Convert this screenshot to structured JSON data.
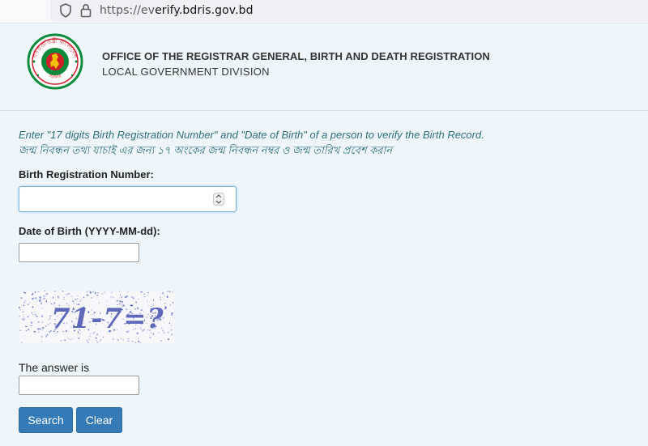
{
  "browser": {
    "url_prefix": "https://ev",
    "url_host": "erify.bdris.gov.bd"
  },
  "header": {
    "logo_name": "government-seal",
    "logo_top_text": "গণপ্রজাতন্ত্রী বাংলাদেশ",
    "logo_bottom_text": "সরকার",
    "title": "OFFICE OF THE REGISTRAR GENERAL, BIRTH AND DEATH REGISTRATION",
    "subtitle": "LOCAL GOVERNMENT DIVISION"
  },
  "instructions": {
    "english": "Enter \"17 digits Birth Registration Number\" and \"Date of Birth\" of a person to verify the Birth Record.",
    "bangla": "জন্ম নিবন্ধন তথ্য যাচাই এর জন্য ১৭ অংকের জন্ম নিবন্ধন নম্বর ও জন্ম তারিখ প্রবেশ করান"
  },
  "form": {
    "brn_label": "Birth Registration Number:",
    "brn_value": "",
    "dob_label": "Date of Birth (YYYY-MM-dd):",
    "dob_value": "",
    "captcha_text": "71-7=?",
    "answer_label": "The answer is",
    "answer_value": "",
    "search_label": "Search",
    "clear_label": "Clear"
  },
  "colors": {
    "instruction_text": "#2e6f77",
    "button_primary": "#337ab7",
    "page_background": "#eef6fb",
    "seal_green": "#0a8a3a",
    "seal_red": "#d21e2b"
  },
  "icons": [
    "shield-icon",
    "lock-icon",
    "number-spinner-icon"
  ]
}
